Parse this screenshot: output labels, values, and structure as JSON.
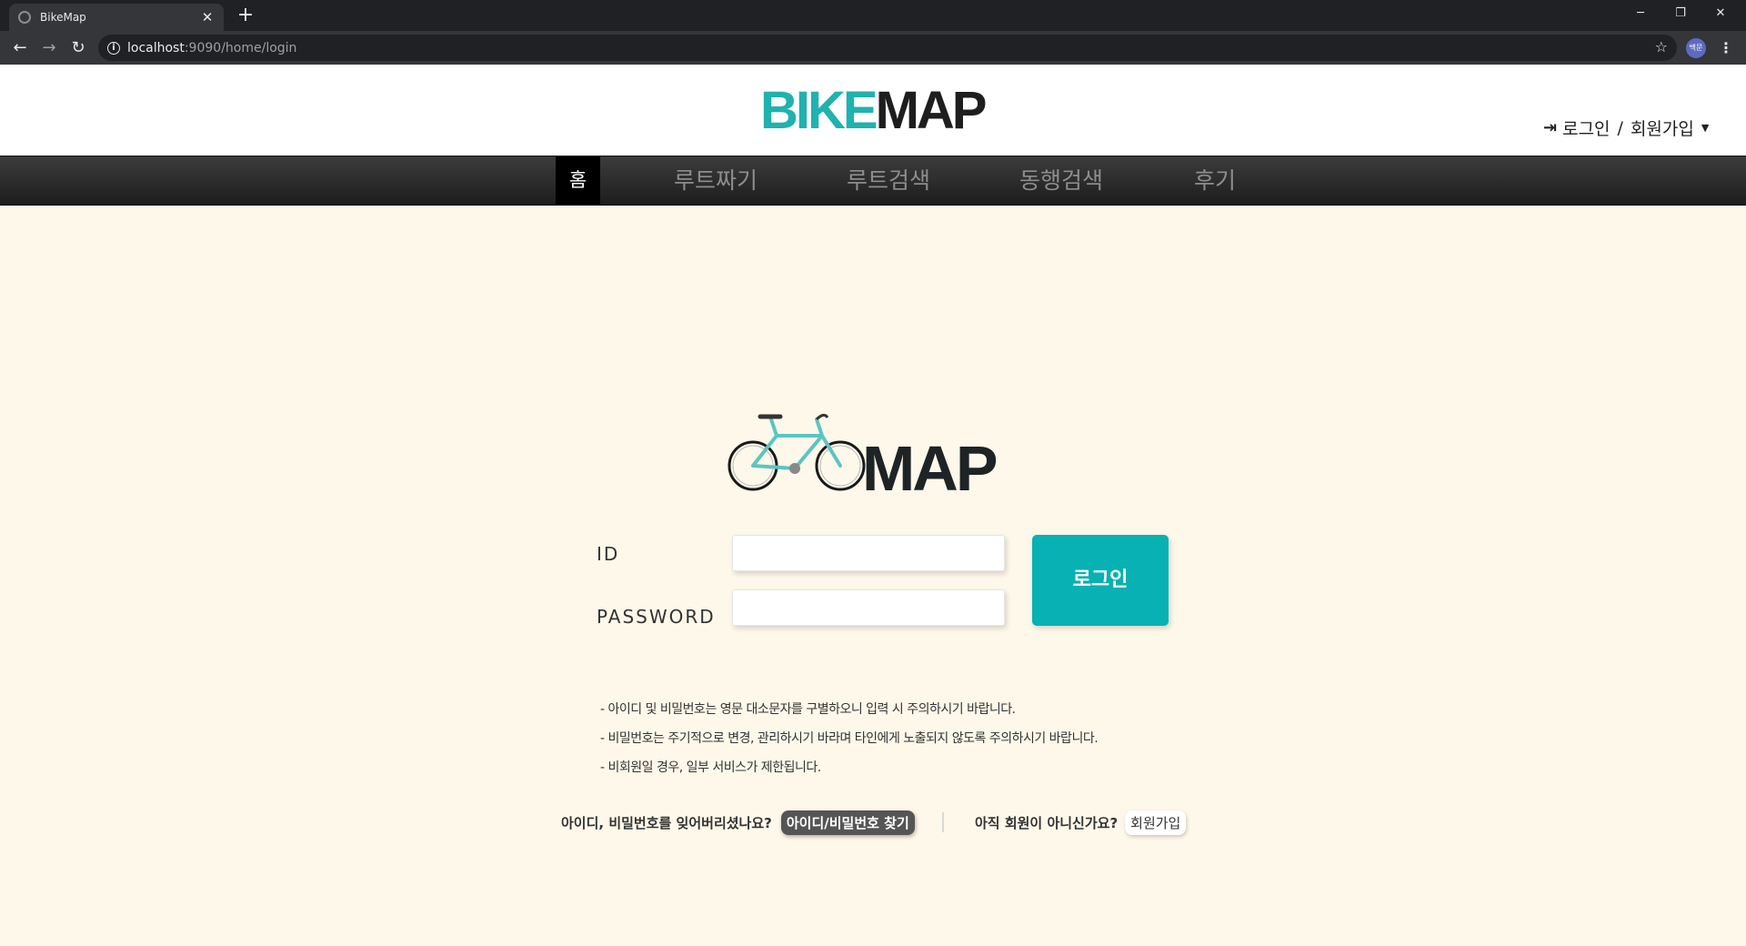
{
  "browser": {
    "tab_title": "BikeMap",
    "url_host": "localhost",
    "url_rest": ":9090/home/login",
    "profile_initials": "백문"
  },
  "header": {
    "logo_bike": "BIKE",
    "logo_map": "MAP",
    "login_label": "로그인",
    "separator": "/",
    "signup_label": "회원가입"
  },
  "nav": {
    "items": [
      {
        "label": "홈"
      },
      {
        "label": "루트짜기"
      },
      {
        "label": "루트검색"
      },
      {
        "label": "동행검색"
      },
      {
        "label": "후기"
      }
    ]
  },
  "login": {
    "logo_text": "MAP",
    "id_label": "ID",
    "password_label": "PASSWORD",
    "id_value": "",
    "password_value": "",
    "button_label": "로그인"
  },
  "notices": [
    "- 아이디 및 비밀번호는 영문 대소문자를 구별하오니 입력 시 주의하시기 바랍니다.",
    "- 비밀번호는 주기적으로 변경, 관리하시기 바라며 타인에게 노출되지 않도록 주의하시기 바랍니다.",
    "- 비회원일 경우, 일부 서비스가 제한됩니다."
  ],
  "footer_links": {
    "forgot_text": "아이디, 비밀번호를 잊어버리셨나요?",
    "find_button": "아이디/비밀번호 찾기",
    "not_member_text": "아직 회원이 아니신가요?",
    "signup_button": "회원가입"
  },
  "colors": {
    "accent": "#08b1b3",
    "background": "#fdf8ea",
    "nav_bg": "#2b2b2b"
  }
}
